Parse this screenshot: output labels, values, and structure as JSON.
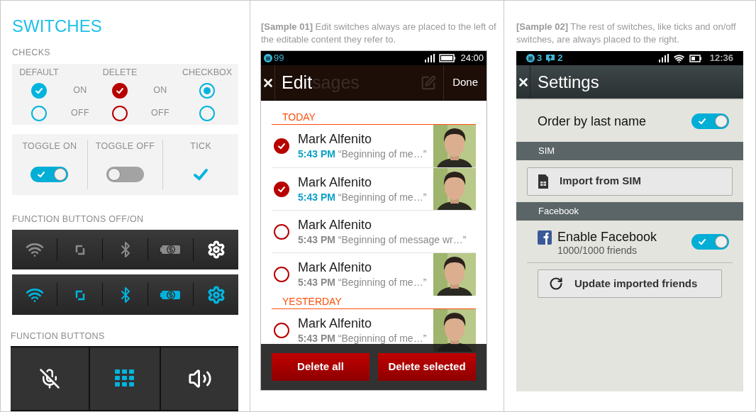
{
  "title": "SWITCHES",
  "checks": {
    "label": "CHECKS",
    "headings": [
      "DEFAULT",
      "DELETE",
      "CHECKBOX"
    ],
    "rows": [
      {
        "cells": [
          {
            "kind": "default",
            "checked": true
          },
          {
            "kind": "label",
            "text": "ON"
          },
          {
            "kind": "delete",
            "checked": true
          },
          {
            "kind": "label",
            "text": "ON"
          },
          {
            "kind": "radio",
            "checked": true
          }
        ]
      },
      {
        "cells": [
          {
            "kind": "default",
            "checked": false
          },
          {
            "kind": "label",
            "text": "OFF"
          },
          {
            "kind": "delete",
            "checked": false
          },
          {
            "kind": "label",
            "text": "OFF"
          },
          {
            "kind": "radio",
            "checked": false
          }
        ]
      }
    ]
  },
  "toggles": [
    {
      "heading": "TOGGLE ON",
      "kind": "toggle",
      "on": true
    },
    {
      "heading": "TOGGLE OFF",
      "kind": "toggle",
      "on": false
    },
    {
      "heading": "TICK",
      "kind": "tick",
      "on": true
    }
  ],
  "function_bars": {
    "label": "FUNCTION BUTTONS OFF/ON",
    "rows": [
      {
        "buttons": [
          {
            "kind": "wifi",
            "on": false
          },
          {
            "kind": "rotate",
            "on": false
          },
          {
            "kind": "bluetooth",
            "on": false
          },
          {
            "kind": "money",
            "on": false
          },
          {
            "kind": "settings",
            "on": false
          }
        ]
      },
      {
        "buttons": [
          {
            "kind": "wifi",
            "on": true
          },
          {
            "kind": "rotate",
            "on": true
          },
          {
            "kind": "bluetooth",
            "on": true
          },
          {
            "kind": "money",
            "on": true
          },
          {
            "kind": "settings",
            "on": true
          }
        ]
      }
    ]
  },
  "function_buttons": {
    "label": "FUNCTION BUTTONS",
    "buttons": [
      {
        "kind": "mute",
        "on": false
      },
      {
        "kind": "keypad",
        "on": true
      },
      {
        "kind": "speaker",
        "on": false
      }
    ]
  },
  "sample1": {
    "caption": "**[Sample 01]** Edit switches always are placed to the left of the editable content they refer to.",
    "status": {
      "count": "99",
      "time": "24:00"
    },
    "header": {
      "title": "Edit",
      "ghost_title": "sages",
      "action": "Done"
    },
    "sections": [
      {
        "heading": "TODAY",
        "items": [
          {
            "name": "Mark Alfenito",
            "time": "5:43 PM",
            "preview": "“Beginning of me…”",
            "selected": true,
            "photo": true
          },
          {
            "name": "Mark Alfenito",
            "time": "5:43 PM",
            "preview": "“Beginning of me…”",
            "selected": true,
            "photo": true
          },
          {
            "name": "Mark Alfenito",
            "time": "5:43 PM",
            "preview": "“Beginning of message wr…”",
            "selected": false,
            "photo": false
          },
          {
            "name": "Mark Alfenito",
            "time": "5:43 PM",
            "preview": "“Beginning of me…”",
            "selected": false,
            "photo": true
          }
        ]
      },
      {
        "heading": "YESTERDAY",
        "items": [
          {
            "name": "Mark Alfenito",
            "time": "5:43 PM",
            "preview": "“Beginning of me…”",
            "selected": false,
            "photo": true
          }
        ]
      }
    ],
    "actions": [
      "Delete all",
      "Delete selected"
    ]
  },
  "sample2": {
    "caption": "**[Sample 02]** The rest of switches, like ticks and on/off switches, are always placed to the right.",
    "status": {
      "notifications": [
        {
          "kind": "notification",
          "count": "3"
        },
        {
          "kind": "message",
          "count": "2"
        }
      ],
      "time": "12:36"
    },
    "header": {
      "title": "Settings"
    },
    "items": [
      {
        "kind": "toggle",
        "label": "Order by last name",
        "on": true
      },
      {
        "kind": "section",
        "label": "SIM"
      },
      {
        "kind": "import",
        "label": "Import from SIM"
      },
      {
        "kind": "section",
        "label": "Facebook"
      },
      {
        "kind": "account",
        "label": "Enable Facebook",
        "sublabel": "1000/1000 friends",
        "on": true
      },
      {
        "kind": "sync",
        "label": "Update imported friends"
      }
    ]
  }
}
